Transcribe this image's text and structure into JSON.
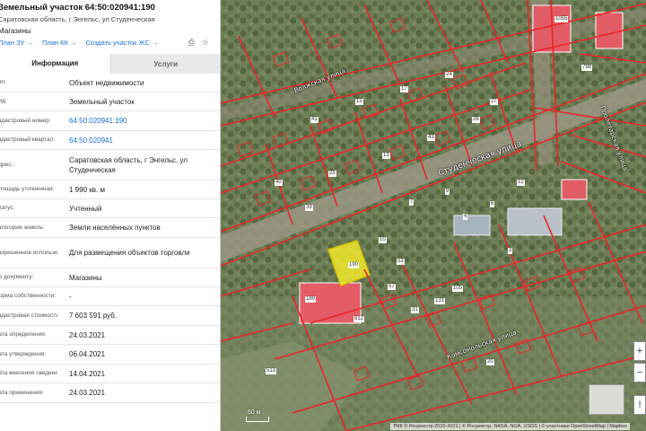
{
  "object": {
    "title": "Земельный участок 64:50:020941:190",
    "address_short": "Саратовская область, г Энгельс, ул Студенческая",
    "purpose": "Магазины"
  },
  "links": {
    "plan_zu": "План ЗУ →",
    "plan_kk": "План КК →",
    "create_zhs": "Создать участок ЖС →"
  },
  "icons": {
    "print": "⎙",
    "star": "☆"
  },
  "tabs": [
    {
      "label": "Информация",
      "active": true
    },
    {
      "label": "Услуги",
      "active": false
    }
  ],
  "rows": [
    {
      "label": "Тип:",
      "value": "Объект недвижимости",
      "link": false
    },
    {
      "label": "Вид:",
      "value": "Земельный участок",
      "link": false
    },
    {
      "label": "Кадастровый номер:",
      "value": "64:50:020941:190",
      "link": true
    },
    {
      "label": "Кадастровый квартал:",
      "value": "64:50:020941",
      "link": true
    },
    {
      "label": "Адрес:",
      "value": "Саратовская область, г Энгельс, ул Студенческая",
      "link": false
    },
    {
      "label": "Площадь уточненная:",
      "value": "1 990 кв. м",
      "link": false
    },
    {
      "label": "Статус:",
      "value": "Учтенный",
      "link": false
    },
    {
      "label": "Категория земель:",
      "value": "Земли населённых пунктов",
      "link": false
    },
    {
      "label": "Разрешенное использование:",
      "value": "Для размещения объектов торговли",
      "link": false
    },
    {
      "label": "По документу:",
      "value": "Магазины",
      "link": false
    },
    {
      "label": "Форма собственности:",
      "value": "-",
      "link": false
    },
    {
      "label": "Кадастровая стоимость:",
      "value": "7 603 591 руб.",
      "link": false
    },
    {
      "label": "Дата определения:",
      "value": "24.03.2021",
      "link": false
    },
    {
      "label": "Дата утверждения:",
      "value": "06.04.2021",
      "link": false
    },
    {
      "label": "Дата внесения сведений:",
      "value": "14.04.2021",
      "link": false
    },
    {
      "label": "Дата применения:",
      "value": "24.03.2021",
      "link": false
    }
  ],
  "map": {
    "streets": {
      "main": "Студенческая улица",
      "upper": "Волжская улица",
      "right": "Пролетарская улица",
      "lower": "Комсомольская улица"
    },
    "scale_label": "60 м",
    "attribution": "ПКК © Росреестр 2010-2021 | © Росреестр, NASA, NGA, USGS | © участники OpenStreetMap | Mapbox",
    "parcel_labels": [
      "1055",
      "798",
      "189",
      "190",
      "512",
      "513",
      "131",
      "39",
      "10",
      "105",
      "57",
      "53",
      "31",
      "20",
      "3",
      "7",
      "9",
      "4",
      "6",
      "12",
      "13",
      "25",
      "40",
      "43",
      "28",
      "15",
      "17",
      "24",
      "41",
      "27"
    ],
    "selected_parcel": "190",
    "colors": {
      "boundary": "#e8262a",
      "selected": "#f2e82d",
      "building": "#e45c66"
    },
    "icons": [
      "zoom-in-icon",
      "zoom-out-icon",
      "more-icon"
    ]
  }
}
